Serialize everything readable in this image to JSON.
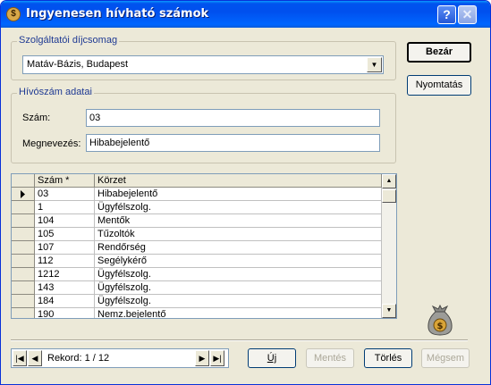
{
  "window": {
    "title": "Ingyenesen hívható számok",
    "help_glyph": "?",
    "close_glyph": "✕",
    "app_icon": "money-bag-icon"
  },
  "package_group": {
    "legend": "Szolgáltatói díjcsomag",
    "selected": "Matáv-Bázis, Budapest"
  },
  "number_group": {
    "legend": "Hívószám adatai",
    "number_label": "Szám:",
    "number_value": "03",
    "name_label": "Megnevezés:",
    "name_value": "Hibabejelentő"
  },
  "buttons": {
    "close": "Bezár",
    "print": "Nyomtatás",
    "new": "Új",
    "save": "Mentés",
    "delete": "Törlés",
    "cancel": "Mégsem"
  },
  "grid": {
    "columns": [
      "Szám *",
      "Körzet"
    ],
    "rows": [
      {
        "num": "03",
        "area": "Hibabejelentő",
        "current": true
      },
      {
        "num": "1",
        "area": "Ügyfélszolg."
      },
      {
        "num": "104",
        "area": "Mentők"
      },
      {
        "num": "105",
        "area": "Tűzoltók"
      },
      {
        "num": "107",
        "area": "Rendőrség"
      },
      {
        "num": "112",
        "area": "Segélykérő"
      },
      {
        "num": "1212",
        "area": "Ügyfélszolg."
      },
      {
        "num": "143",
        "area": "Ügyfélszolg."
      },
      {
        "num": "184",
        "area": "Ügyfélszolg."
      },
      {
        "num": "190",
        "area": "Nemz.bejelentő"
      }
    ]
  },
  "navigator": {
    "record_text": "Rekord: 1 / 12"
  },
  "colors": {
    "title_bar": "#0054e3",
    "dialog_bg": "#ece9d8",
    "group_legend": "#1f3a93"
  }
}
